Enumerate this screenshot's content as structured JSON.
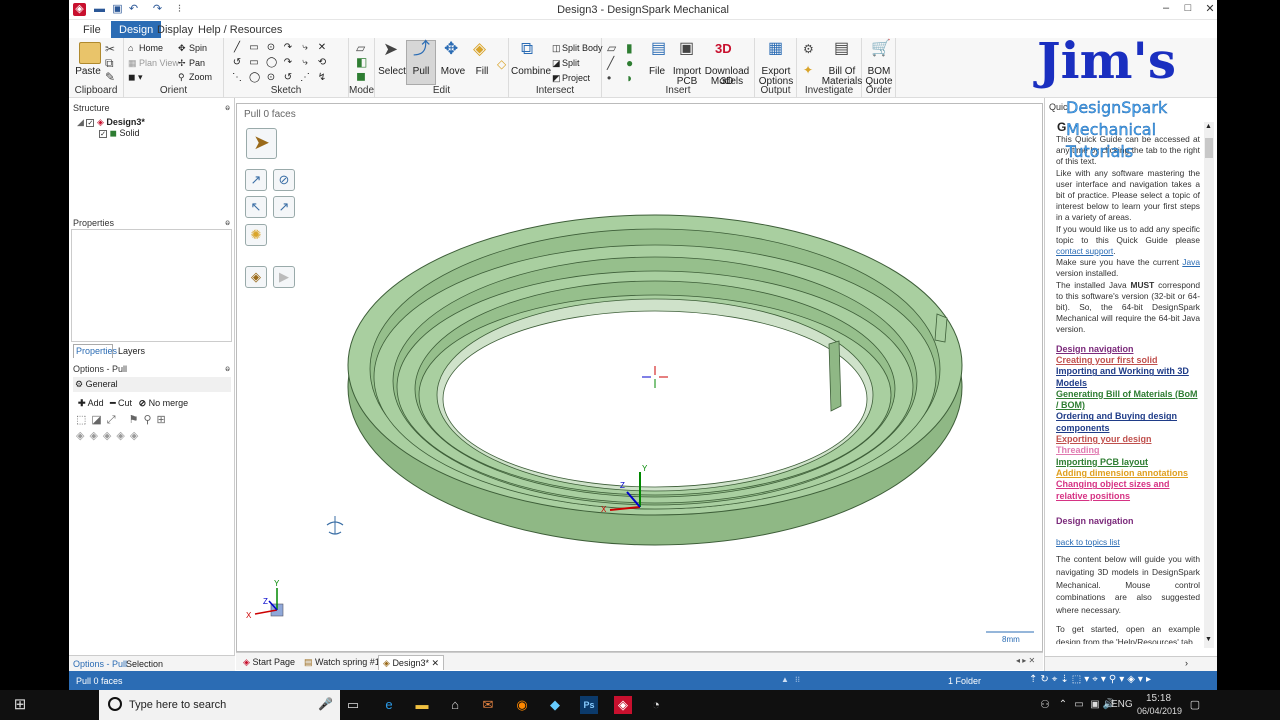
{
  "window": {
    "title": "Design3 - DesignSpark Mechanical",
    "controls": [
      "–",
      "□",
      "✕"
    ],
    "ribbon_controls": [
      "▲",
      "?",
      "⇗",
      "✕"
    ]
  },
  "ribbon_tabs": [
    "File",
    "Design",
    "Display",
    "Help / Resources"
  ],
  "ribbon": {
    "clipboard": {
      "paste": "Paste",
      "group": "Clipboard"
    },
    "orient": {
      "home": "Home",
      "plan_view": "Plan View",
      "spin": "Spin",
      "pan": "Pan",
      "zoom": "Zoom",
      "group": "Orient"
    },
    "sketch": {
      "group": "Sketch"
    },
    "mode": {
      "group": "Mode"
    },
    "edit": {
      "select": "Select",
      "pull": "Pull",
      "move": "Move",
      "fill": "Fill",
      "group": "Edit"
    },
    "intersect": {
      "combine": "Combine",
      "split_body": "Split Body",
      "split": "Split",
      "project": "Project",
      "group": "Intersect"
    },
    "insert": {
      "file": "File",
      "import_pcb_1": "Import",
      "import_pcb_2": "PCB",
      "download_1": "Download 3D",
      "download_2": "Models",
      "group": "Insert"
    },
    "output": {
      "export_1": "Export",
      "export_2": "Options",
      "group": "Output"
    },
    "investigate": {
      "bom_1": "Bill Of",
      "bom_2": "Materials",
      "group": "Investigate"
    },
    "order": {
      "quote_1": "BOM",
      "quote_2": "Quote",
      "group": "Order"
    }
  },
  "structure": {
    "title": "Structure",
    "root": "Design3*",
    "child": "Solid"
  },
  "properties": {
    "title": "Properties",
    "tabs": [
      "Properties",
      "Layers"
    ]
  },
  "options": {
    "title": "Options - Pull",
    "general": "General",
    "add": "Add",
    "cut": "Cut",
    "no_merge": "No merge",
    "bottom_tabs": [
      "Options - Pull",
      "Selection"
    ]
  },
  "viewport": {
    "hint": "Pull 0 faces",
    "scale": "8mm",
    "axis_x": "X",
    "axis_y": "Y",
    "axis_z": "Z"
  },
  "doc_tabs": [
    "Start Page",
    "Watch spring #1",
    "Design3*"
  ],
  "quick_guide": {
    "header": "Quic",
    "title_partial": "G",
    "intro": [
      "This Quick Guide can be accessed at any time by clicking the tab to the right of this text.",
      "Like with any software mastering the user interface and navigation takes a bit of practice. Please select a topic of interest below to learn your first steps in a variety of areas.",
      "If you would like us to add any specific topic to this Quick Guide please",
      "Make sure you have the current",
      "version installed.",
      "The installed Java",
      "correspond to this software's version (32-bit or 64-bit). So, the 64-bit DesignSpark Mechanical will require the 64-bit Java version."
    ],
    "contact": "contact support",
    "java": "Java",
    "must": "MUST",
    "links": [
      {
        "text": "Design navigation",
        "color": "#7b2a7b"
      },
      {
        "text": "Creating your first solid",
        "color": "#c0504d"
      },
      {
        "text": "Importing and Working with 3D Models",
        "color": "#1f3c88"
      },
      {
        "text": "Generating Bill of Materials (BoM / BOM)",
        "color": "#2e7d32"
      },
      {
        "text": "Ordering and Buying design components",
        "color": "#1f3c88"
      },
      {
        "text": "Exporting your design",
        "color": "#c0504d"
      },
      {
        "text": "Threading",
        "color": "#e07ab0"
      },
      {
        "text": "Importing PCB layout",
        "color": "#2e7d32"
      },
      {
        "text": "Adding dimension annotations",
        "color": "#e0a020"
      },
      {
        "text": "Changing object sizes and relative positions",
        "color": "#d63384"
      }
    ],
    "section_title": "Design navigation",
    "back_link": "back to topics list",
    "section_body": "The content below will guide you with navigating 3D models in DesignSpark Mechanical. Mouse control combinations are also suggested where necessary.",
    "section_body2": "To get started, open an example design from the 'Help/Resources' tab."
  },
  "watermark": {
    "title": "Jim's",
    "line1": "DesignSpark",
    "line2": "Mechanical",
    "line3": "Tutorials"
  },
  "status": {
    "left": "Pull 0 faces",
    "folder": "1 Folder"
  },
  "taskbar": {
    "search": "Type here to search",
    "time": "15:18",
    "date": "06/04/2019",
    "lang": "ENG"
  }
}
